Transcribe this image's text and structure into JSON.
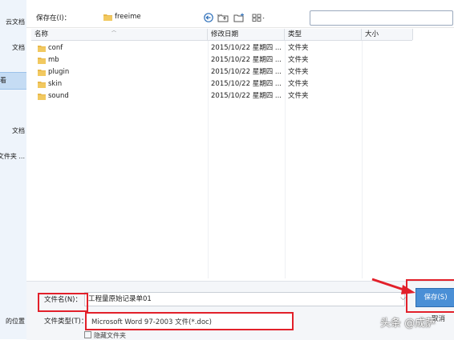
{
  "sidebar": {
    "items": [
      {
        "label": "云文档"
      },
      {
        "label": "文档"
      },
      {
        "label": "看"
      },
      {
        "label": "文档"
      },
      {
        "label": "文件夹 ..."
      },
      {
        "label": "的位置"
      }
    ]
  },
  "toolbar": {
    "save_in_label": "保存在(I)：",
    "current_folder": "freeime",
    "icons": [
      "back-icon",
      "up-folder-icon",
      "new-folder-icon",
      "views-menu-icon"
    ]
  },
  "columns": [
    "名称",
    "修改日期",
    "类型",
    "大小"
  ],
  "files": [
    {
      "name": "conf",
      "date": "2015/10/22 星期四 ...",
      "type": "文件夹"
    },
    {
      "name": "mb",
      "date": "2015/10/22 星期四 ...",
      "type": "文件夹"
    },
    {
      "name": "plugin",
      "date": "2015/10/22 星期四 ...",
      "type": "文件夹"
    },
    {
      "name": "skin",
      "date": "2015/10/22 星期四 ...",
      "type": "文件夹"
    },
    {
      "name": "sound",
      "date": "2015/10/22 星期四 ...",
      "type": "文件夹"
    }
  ],
  "form": {
    "filename_label": "文件名(N)：",
    "filename_value": "工程量原始记录单01",
    "filetype_label": "文件类型(T)：",
    "filetype_value": "Microsoft Word 97-2003 文件(*.doc)",
    "hide_folders_label": "隐藏文件夹"
  },
  "buttons": {
    "save": "保存(S)",
    "cancel": "取消"
  },
  "watermark": "头条 @成萨",
  "colors": {
    "accent": "#4a8fd6",
    "highlight": "#e2202a",
    "folder": "#e8b84a"
  }
}
